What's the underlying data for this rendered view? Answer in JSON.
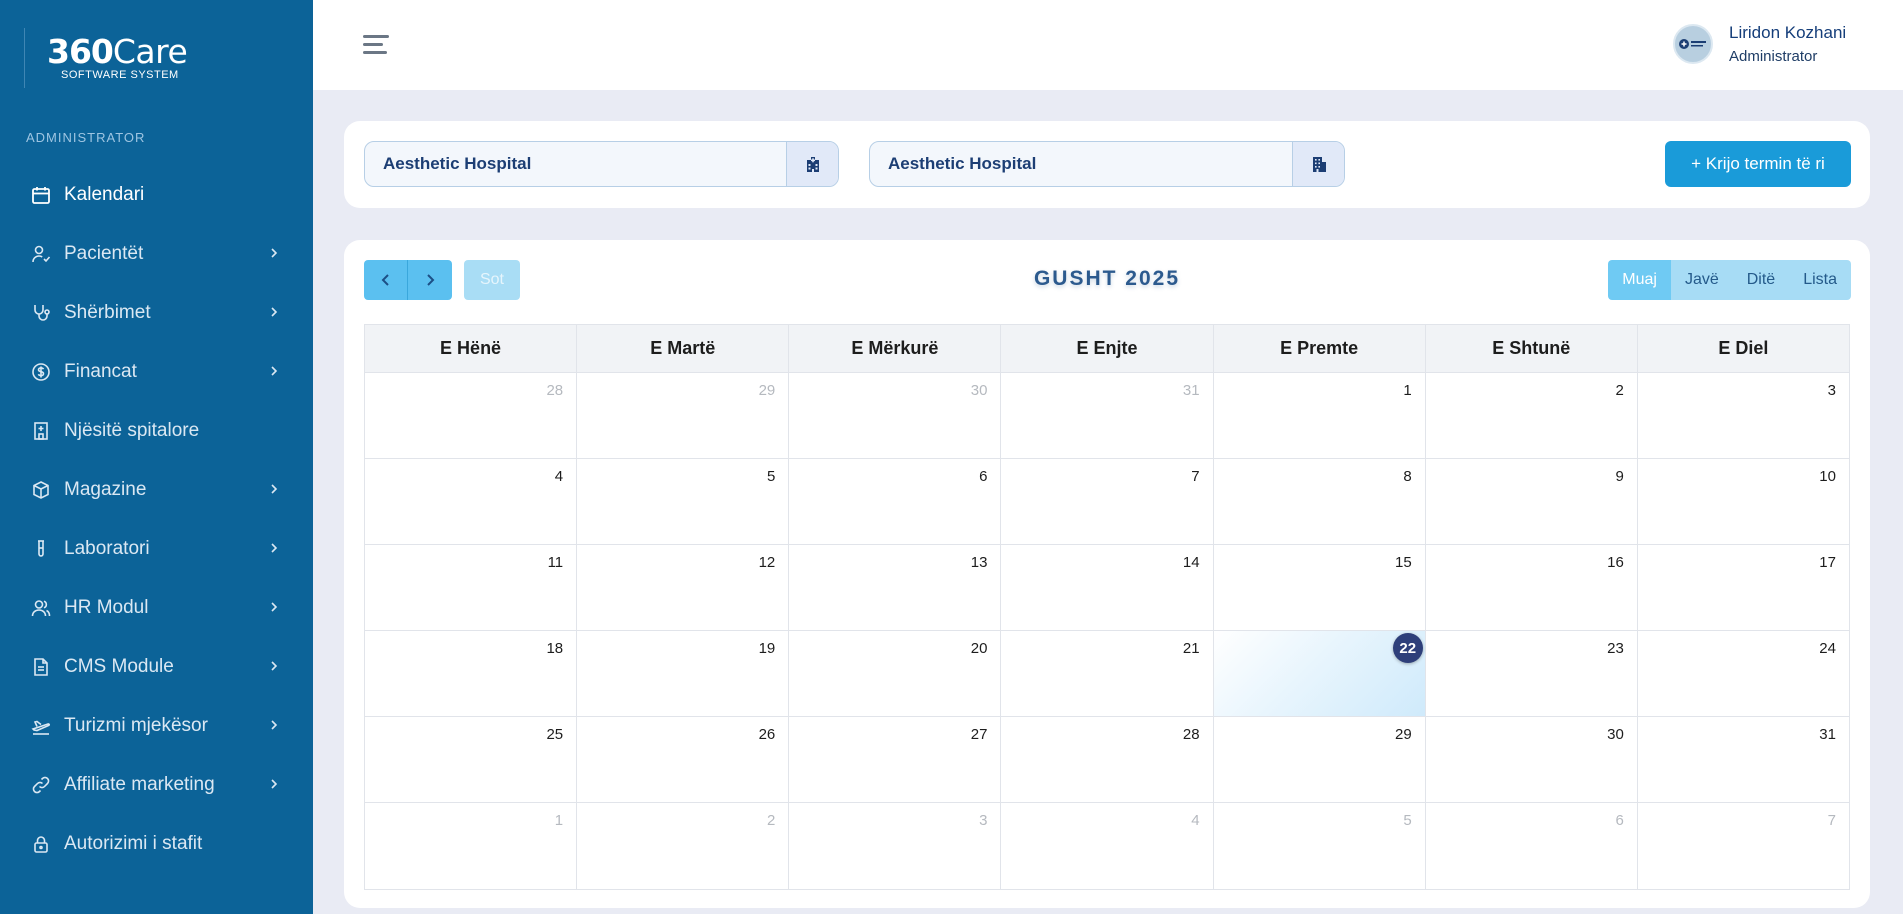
{
  "brand": {
    "name_bold": "360",
    "name_rest": "Care",
    "tagline": "SOFTWARE SYSTEM"
  },
  "sidebar": {
    "role": "ADMINISTRATOR",
    "items": [
      {
        "label": "Kalendari",
        "icon": "calendar-icon",
        "has_submenu": false,
        "active": true
      },
      {
        "label": "Pacientët",
        "icon": "user-icon",
        "has_submenu": true
      },
      {
        "label": "Shërbimet",
        "icon": "stethoscope-icon",
        "has_submenu": true
      },
      {
        "label": "Financat",
        "icon": "dollar-icon",
        "has_submenu": true
      },
      {
        "label": "Njësitë spitalore",
        "icon": "hospital-icon",
        "has_submenu": false
      },
      {
        "label": "Magazine",
        "icon": "box-icon",
        "has_submenu": true
      },
      {
        "label": "Laboratori",
        "icon": "test-tube-icon",
        "has_submenu": true
      },
      {
        "label": "HR Modul",
        "icon": "users-icon",
        "has_submenu": true
      },
      {
        "label": "CMS Module",
        "icon": "document-icon",
        "has_submenu": true
      },
      {
        "label": "Turizmi mjekësor",
        "icon": "plane-icon",
        "has_submenu": true
      },
      {
        "label": "Affiliate marketing",
        "icon": "link-icon",
        "has_submenu": true
      },
      {
        "label": "Autorizimi i stafit",
        "icon": "lock-icon",
        "has_submenu": false
      }
    ]
  },
  "header": {
    "user_name": "Liridon Kozhani",
    "user_role": "Administrator"
  },
  "filters": {
    "hospital_1": "Aesthetic Hospital",
    "hospital_2": "Aesthetic Hospital",
    "create_button": "+ Krijo termin të ri"
  },
  "calendar": {
    "title": "GUSHT 2025",
    "today_button": "Sot",
    "views": [
      "Muaj",
      "Javë",
      "Ditë",
      "Lista"
    ],
    "active_view": "Muaj",
    "weekdays": [
      "E Hënë",
      "E Martë",
      "E Mërkurë",
      "E Enjte",
      "E Premte",
      "E Shtunë",
      "E Diel"
    ],
    "today": 22,
    "weeks": [
      [
        {
          "d": "28",
          "o": true
        },
        {
          "d": "29",
          "o": true
        },
        {
          "d": "30",
          "o": true
        },
        {
          "d": "31",
          "o": true
        },
        {
          "d": "1"
        },
        {
          "d": "2"
        },
        {
          "d": "3"
        }
      ],
      [
        {
          "d": "4"
        },
        {
          "d": "5"
        },
        {
          "d": "6"
        },
        {
          "d": "7"
        },
        {
          "d": "8"
        },
        {
          "d": "9"
        },
        {
          "d": "10"
        }
      ],
      [
        {
          "d": "11"
        },
        {
          "d": "12"
        },
        {
          "d": "13"
        },
        {
          "d": "14"
        },
        {
          "d": "15"
        },
        {
          "d": "16"
        },
        {
          "d": "17"
        }
      ],
      [
        {
          "d": "18"
        },
        {
          "d": "19"
        },
        {
          "d": "20"
        },
        {
          "d": "21"
        },
        {
          "d": "22",
          "t": true
        },
        {
          "d": "23"
        },
        {
          "d": "24"
        }
      ],
      [
        {
          "d": "25"
        },
        {
          "d": "26"
        },
        {
          "d": "27"
        },
        {
          "d": "28"
        },
        {
          "d": "29"
        },
        {
          "d": "30"
        },
        {
          "d": "31"
        }
      ],
      [
        {
          "d": "1",
          "o": true
        },
        {
          "d": "2",
          "o": true
        },
        {
          "d": "3",
          "o": true
        },
        {
          "d": "4",
          "o": true
        },
        {
          "d": "5",
          "o": true
        },
        {
          "d": "6",
          "o": true
        },
        {
          "d": "7",
          "o": true
        }
      ]
    ]
  }
}
